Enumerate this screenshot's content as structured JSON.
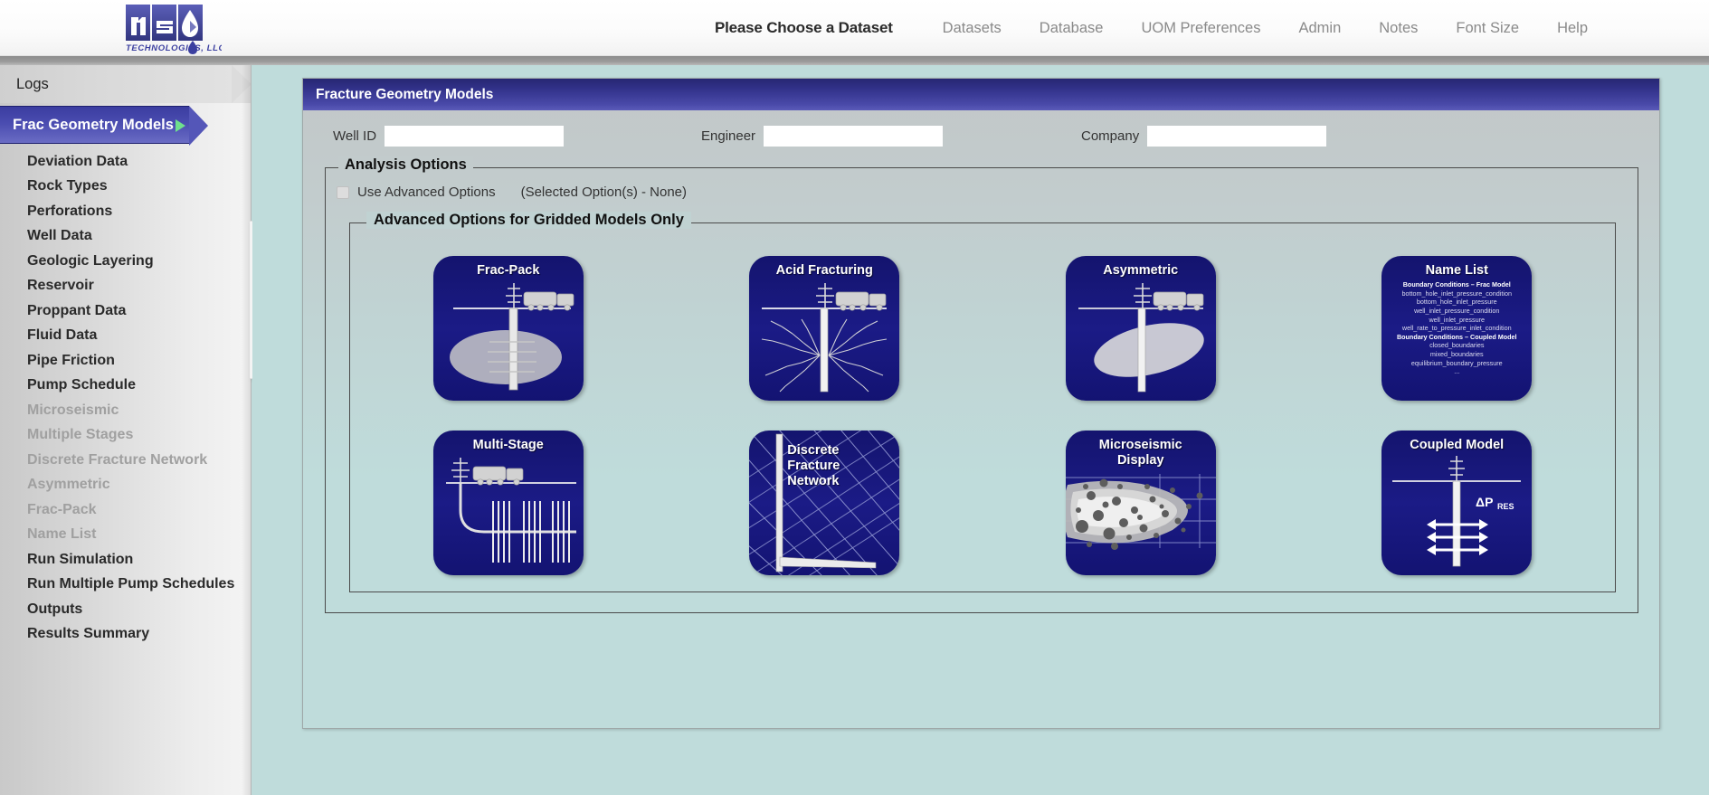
{
  "brand": {
    "logo_text": "nsi",
    "logo_subtext": "TECHNOLOGIES, LLC.",
    "logo_color": "#3b3fa0"
  },
  "topbar": {
    "dataset_title": "Please Choose a Dataset",
    "nav_links": [
      {
        "label": "Datasets"
      },
      {
        "label": "Database"
      },
      {
        "label": "UOM Preferences"
      },
      {
        "label": "Admin"
      },
      {
        "label": "Notes"
      },
      {
        "label": "Font Size"
      },
      {
        "label": "Help"
      }
    ]
  },
  "sidebar": {
    "top_item": "Logs",
    "active_item": "Frac Geometry Models",
    "items": [
      {
        "label": "Deviation Data",
        "disabled": false
      },
      {
        "label": "Rock Types",
        "disabled": false
      },
      {
        "label": "Perforations",
        "disabled": false
      },
      {
        "label": "Well Data",
        "disabled": false
      },
      {
        "label": "Geologic Layering",
        "disabled": false
      },
      {
        "label": "Reservoir",
        "disabled": false
      },
      {
        "label": "Proppant Data",
        "disabled": false
      },
      {
        "label": "Fluid Data",
        "disabled": false
      },
      {
        "label": "Pipe Friction",
        "disabled": false
      },
      {
        "label": "Pump Schedule",
        "disabled": false
      },
      {
        "label": "Microseismic",
        "disabled": true
      },
      {
        "label": "Multiple Stages",
        "disabled": true
      },
      {
        "label": "Discrete Fracture Network",
        "disabled": true
      },
      {
        "label": "Asymmetric",
        "disabled": true
      },
      {
        "label": "Frac-Pack",
        "disabled": true
      },
      {
        "label": "Name List",
        "disabled": true
      },
      {
        "label": "Run Simulation",
        "disabled": false
      },
      {
        "label": "Run Multiple Pump Schedules",
        "disabled": false
      },
      {
        "label": "Outputs",
        "disabled": false
      },
      {
        "label": "Results Summary",
        "disabled": false
      }
    ]
  },
  "panel": {
    "title": "Fracture Geometry Models",
    "accent_color": "#33338c",
    "fields": [
      {
        "label": "Well ID",
        "value": "",
        "placeholder": ""
      },
      {
        "label": "Engineer",
        "value": "",
        "placeholder": ""
      },
      {
        "label": "Company",
        "value": "",
        "placeholder": ""
      }
    ],
    "analysis_legend": "Analysis Options",
    "advanced_checkbox_label": "Use Advanced Options",
    "advanced_checkbox_checked": false,
    "selected_options_note": "(Selected Option(s) - None)",
    "advanced_legend": "Advanced Options for Gridded Models Only"
  },
  "tiles": [
    {
      "id": "frac-pack",
      "title": "Frac-Pack"
    },
    {
      "id": "acid-fracturing",
      "title": "Acid Fracturing"
    },
    {
      "id": "asymmetric",
      "title": "Asymmetric"
    },
    {
      "id": "name-list",
      "title": "Name List"
    },
    {
      "id": "multi-stage",
      "title": "Multi-Stage"
    },
    {
      "id": "discrete-fracture-network",
      "title": "Discrete Fracture Network"
    },
    {
      "id": "microseismic-display",
      "title": "Microseismic Display"
    },
    {
      "id": "coupled-model",
      "title": "Coupled Model"
    }
  ],
  "name_list_tile": {
    "title": "Name List",
    "lines": [
      {
        "text": "Boundary Conditions – Frac Model",
        "head": true
      },
      {
        "text": "bottom_hole_inlet_pressure_condition",
        "head": false
      },
      {
        "text": "bottom_hole_inlet_pressure",
        "head": false
      },
      {
        "text": "well_inlet_pressure_condition",
        "head": false
      },
      {
        "text": "well_inlet_pressure",
        "head": false
      },
      {
        "text": "well_rate_to_pressure_inlet_condition",
        "head": false
      },
      {
        "text": "Boundary Conditions – Coupled Model",
        "head": true
      },
      {
        "text": "closed_boundaries",
        "head": false
      },
      {
        "text": "mixed_boundaries",
        "head": false
      },
      {
        "text": "equilibrium_boundary_pressure",
        "head": false
      },
      {
        "text": "...",
        "head": false
      }
    ]
  },
  "coupled_model_tile": {
    "delta_label": "ΔP",
    "delta_sub": "RES"
  },
  "dfn_tile": {
    "line1": "Discrete",
    "line2": "Fracture",
    "line3": "Network"
  },
  "microseismic_tile": {
    "line1": "Microseismic",
    "line2": "Display"
  }
}
